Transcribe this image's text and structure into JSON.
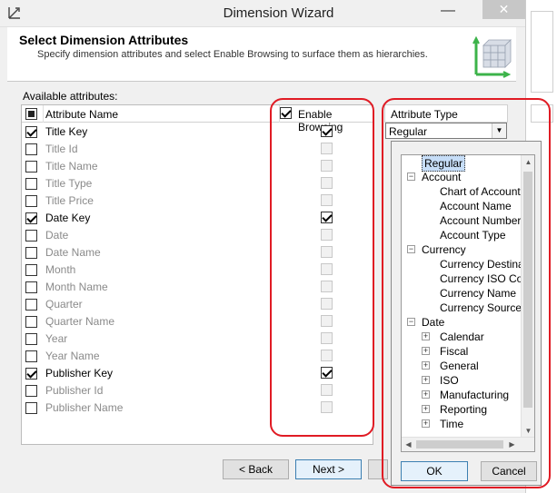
{
  "window": {
    "title": "Dimension Wizard",
    "minimize_glyph": "—",
    "close_glyph": "✕"
  },
  "header": {
    "title": "Select Dimension Attributes",
    "description": "Specify dimension attributes and select Enable Browsing to surface them as hierarchies."
  },
  "attributes": {
    "label": "Available attributes:",
    "columns": {
      "name": "Attribute Name",
      "browsing": "Enable Browsing",
      "type": "Attribute Type"
    },
    "rows": [
      {
        "name": "Title Key",
        "checked": true,
        "browsing": true
      },
      {
        "name": "Title Id",
        "checked": false,
        "browsing": false
      },
      {
        "name": "Title Name",
        "checked": false,
        "browsing": false
      },
      {
        "name": "Title Type",
        "checked": false,
        "browsing": false
      },
      {
        "name": "Title Price",
        "checked": false,
        "browsing": false
      },
      {
        "name": "Date Key",
        "checked": true,
        "browsing": true
      },
      {
        "name": "Date",
        "checked": false,
        "browsing": false
      },
      {
        "name": "Date Name",
        "checked": false,
        "browsing": false
      },
      {
        "name": "Month",
        "checked": false,
        "browsing": false
      },
      {
        "name": "Month Name",
        "checked": false,
        "browsing": false
      },
      {
        "name": "Quarter",
        "checked": false,
        "browsing": false
      },
      {
        "name": "Quarter Name",
        "checked": false,
        "browsing": false
      },
      {
        "name": "Year",
        "checked": false,
        "browsing": false
      },
      {
        "name": "Year Name",
        "checked": false,
        "browsing": false
      },
      {
        "name": "Publisher Key",
        "checked": true,
        "browsing": true
      },
      {
        "name": "Publisher Id",
        "checked": false,
        "browsing": false
      },
      {
        "name": "Publisher Name",
        "checked": false,
        "browsing": false
      }
    ]
  },
  "attribute_type": {
    "selected": "Regular"
  },
  "type_tree": {
    "items": [
      {
        "label": "Regular",
        "level": 1,
        "expander": "",
        "selected": true
      },
      {
        "label": "Account",
        "level": 0,
        "expander": "−"
      },
      {
        "label": "Chart of Accounts",
        "level": 2,
        "expander": ""
      },
      {
        "label": "Account Name",
        "level": 2,
        "expander": ""
      },
      {
        "label": "Account Number",
        "level": 2,
        "expander": ""
      },
      {
        "label": "Account Type",
        "level": 2,
        "expander": ""
      },
      {
        "label": "Currency",
        "level": 0,
        "expander": "−"
      },
      {
        "label": "Currency Destination",
        "level": 2,
        "expander": ""
      },
      {
        "label": "Currency ISO Code",
        "level": 2,
        "expander": ""
      },
      {
        "label": "Currency Name",
        "level": 2,
        "expander": ""
      },
      {
        "label": "Currency Source",
        "level": 2,
        "expander": ""
      },
      {
        "label": "Date",
        "level": 0,
        "expander": "−"
      },
      {
        "label": "Calendar",
        "level": 1,
        "expander": "+"
      },
      {
        "label": "Fiscal",
        "level": 1,
        "expander": "+"
      },
      {
        "label": "General",
        "level": 1,
        "expander": "+"
      },
      {
        "label": "ISO",
        "level": 1,
        "expander": "+"
      },
      {
        "label": "Manufacturing",
        "level": 1,
        "expander": "+"
      },
      {
        "label": "Reporting",
        "level": 1,
        "expander": "+"
      },
      {
        "label": "Time",
        "level": 1,
        "expander": "+"
      }
    ],
    "ok_label": "OK",
    "cancel_label": "Cancel"
  },
  "footer": {
    "back_label": "< Back",
    "next_label": "Next >"
  },
  "colors": {
    "annotation": "#e01b24",
    "selection": "#c6ddf7",
    "default_button_border": "#3c7fb1"
  }
}
